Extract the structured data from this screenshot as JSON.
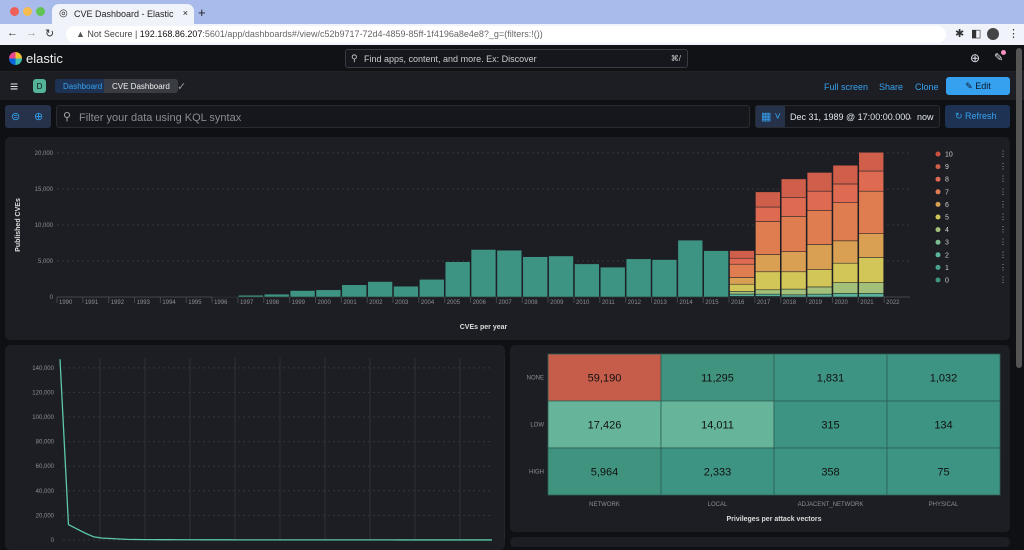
{
  "browser": {
    "tab_title": "CVE Dashboard - Elastic",
    "new_tab": "+",
    "security": "Not Secure",
    "url_host": "192.168.86.207",
    "url_rest": ":5601/app/dashboards#/view/c52b9717-72d4-4859-85ff-1f4196a8e4e8?_g=(filters:!())"
  },
  "header": {
    "logo": "elastic",
    "search_placeholder": "Find apps, content, and more. Ex: Discover",
    "shortcut": "⌘/",
    "space_badge": "D"
  },
  "breadcrumbs": [
    "Dashboard",
    "CVE Dashboard"
  ],
  "actions": {
    "fullscreen": "Full screen",
    "share": "Share",
    "clone": "Clone",
    "edit": "Edit"
  },
  "query": {
    "placeholder": "Filter your data using KQL syntax",
    "time_start": "Dec 31, 1989 @ 17:00:00.000",
    "arrow": "→",
    "time_end": "now",
    "refresh": "Refresh"
  },
  "colors": {
    "accent": "#36a2ef",
    "teal": "#3d9482",
    "red": "#cf5f4a"
  },
  "chart_data": [
    {
      "type": "bar",
      "stacked": true,
      "xlabel": "CVEs per year",
      "ylabel": "Published CVEs",
      "ylim": [
        0,
        20000
      ],
      "yticks": [
        "0",
        "5,000",
        "10,000",
        "15,000",
        "20,000"
      ],
      "grid": "horizontal dashed",
      "legend": "right",
      "categories": [
        "1990",
        "1991",
        "1992",
        "1993",
        "1994",
        "1995",
        "1996",
        "1997",
        "1998",
        "1999",
        "2000",
        "2001",
        "2002",
        "2003",
        "2004",
        "2005",
        "2006",
        "2007",
        "2008",
        "2009",
        "2010",
        "2011",
        "2012",
        "2013",
        "2014",
        "2015",
        "2016",
        "2017",
        "2018",
        "2019",
        "2020",
        "2021",
        "2022"
      ],
      "series": [
        {
          "name": "10",
          "color": "#c9533f",
          "values": [
            0,
            0,
            0,
            0,
            0,
            0,
            0,
            0,
            0,
            0,
            0,
            0,
            0,
            0,
            0,
            0,
            0,
            0,
            0,
            0,
            0,
            0,
            0,
            0,
            0,
            0,
            0,
            0,
            0,
            0,
            0,
            0,
            0
          ]
        },
        {
          "name": "9",
          "color": "#cf5f4a",
          "values": [
            0,
            0,
            0,
            0,
            0,
            0,
            0,
            0,
            0,
            0,
            0,
            0,
            0,
            0,
            0,
            0,
            0,
            0,
            0,
            0,
            0,
            0,
            0,
            0,
            0,
            50,
            1060,
            2100,
            2600,
            2600,
            2600,
            2600,
            0
          ]
        },
        {
          "name": "8",
          "color": "#dd6a51",
          "values": [
            0,
            0,
            0,
            0,
            0,
            0,
            0,
            0,
            0,
            0,
            0,
            0,
            0,
            0,
            0,
            0,
            0,
            0,
            0,
            0,
            0,
            0,
            0,
            0,
            0,
            0,
            830,
            2000,
            2600,
            2700,
            2600,
            2800,
            0
          ]
        },
        {
          "name": "7",
          "color": "#e07d50",
          "values": [
            0,
            0,
            0,
            0,
            0,
            0,
            0,
            0,
            0,
            0,
            0,
            0,
            0,
            0,
            0,
            0,
            0,
            0,
            0,
            0,
            0,
            0,
            0,
            0,
            0,
            0,
            1850,
            4600,
            4900,
            4700,
            5300,
            5900,
            0
          ]
        },
        {
          "name": "6",
          "color": "#d9a054",
          "values": [
            0,
            0,
            0,
            0,
            0,
            0,
            0,
            0,
            0,
            0,
            0,
            0,
            0,
            0,
            0,
            0,
            0,
            0,
            0,
            0,
            0,
            0,
            0,
            0,
            0,
            0,
            930,
            2400,
            2800,
            3500,
            3100,
            3300,
            0
          ]
        },
        {
          "name": "5",
          "color": "#d2c658",
          "values": [
            0,
            0,
            0,
            0,
            0,
            0,
            0,
            0,
            0,
            0,
            0,
            0,
            0,
            0,
            0,
            0,
            0,
            0,
            0,
            0,
            0,
            0,
            0,
            0,
            0,
            0,
            1000,
            2500,
            2400,
            2400,
            2700,
            3500,
            0
          ]
        },
        {
          "name": "4",
          "color": "#a2c07a",
          "values": [
            0,
            0,
            0,
            0,
            0,
            0,
            0,
            0,
            0,
            0,
            0,
            0,
            0,
            0,
            0,
            0,
            0,
            0,
            0,
            0,
            0,
            0,
            0,
            0,
            0,
            0,
            370,
            600,
            800,
            1000,
            1500,
            1500,
            0
          ]
        },
        {
          "name": "3",
          "color": "#7cbb8d",
          "values": [
            0,
            0,
            0,
            0,
            0,
            0,
            0,
            0,
            0,
            0,
            0,
            0,
            0,
            0,
            0,
            0,
            0,
            0,
            0,
            0,
            0,
            0,
            0,
            0,
            0,
            0,
            0,
            0,
            0,
            0,
            0,
            0,
            0
          ]
        },
        {
          "name": "2",
          "color": "#5bb49a",
          "values": [
            0,
            0,
            0,
            0,
            0,
            0,
            0,
            0,
            0,
            0,
            0,
            0,
            0,
            0,
            0,
            0,
            0,
            0,
            0,
            0,
            0,
            0,
            0,
            0,
            0,
            0,
            320,
            300,
            300,
            400,
            500,
            500,
            0
          ]
        },
        {
          "name": "1",
          "color": "#4aa390",
          "values": [
            0,
            0,
            0,
            0,
            0,
            0,
            0,
            0,
            0,
            0,
            0,
            0,
            0,
            0,
            0,
            0,
            0,
            0,
            0,
            0,
            0,
            0,
            0,
            0,
            0,
            0,
            0,
            0,
            0,
            0,
            0,
            0,
            0
          ]
        },
        {
          "name": "0",
          "color": "#3d9482",
          "values": [
            0,
            0,
            0,
            0,
            0,
            0,
            75,
            250,
            400,
            900,
            1000,
            1700,
            2150,
            1500,
            2450,
            4900,
            6600,
            6500,
            5600,
            5700,
            4600,
            4150,
            5300,
            5200,
            7900,
            6450,
            90,
            100,
            0,
            0,
            0,
            0,
            0
          ]
        }
      ]
    },
    {
      "type": "line",
      "ylim": [
        0,
        148000
      ],
      "yticks": [
        "0",
        "20,000",
        "40,000",
        "60,000",
        "80,000",
        "100,000",
        "120,000",
        "140,000"
      ],
      "color": "#5cc8a8",
      "values": [
        147000,
        12500,
        9000,
        5500,
        2500,
        1500,
        1200,
        800,
        500,
        400,
        300,
        300,
        250,
        250,
        200,
        200,
        200,
        150,
        150,
        150,
        150,
        100,
        100,
        100,
        100,
        100,
        100,
        100,
        100,
        100,
        100,
        100,
        80,
        80,
        80,
        80,
        80,
        80,
        80,
        80,
        60,
        60,
        60,
        60,
        60,
        60,
        60,
        60,
        60,
        60,
        50,
        50
      ]
    },
    {
      "type": "heatmap",
      "title": "Privileges per attack vectors",
      "columns": [
        "NETWORK",
        "LOCAL",
        "ADJACENT_NETWORK",
        "PHYSICAL"
      ],
      "rows": [
        "NONE",
        "LOW",
        "HIGH"
      ],
      "values": [
        [
          59190,
          11295,
          1831,
          1032
        ],
        [
          17426,
          14011,
          315,
          134
        ],
        [
          5964,
          2333,
          358,
          75
        ]
      ],
      "labels": [
        [
          "59,190",
          "11,295",
          "1,831",
          "1,032"
        ],
        [
          "17,426",
          "14,011",
          "315",
          "134"
        ],
        [
          "5,964",
          "2,333",
          "358",
          "75"
        ]
      ]
    }
  ]
}
